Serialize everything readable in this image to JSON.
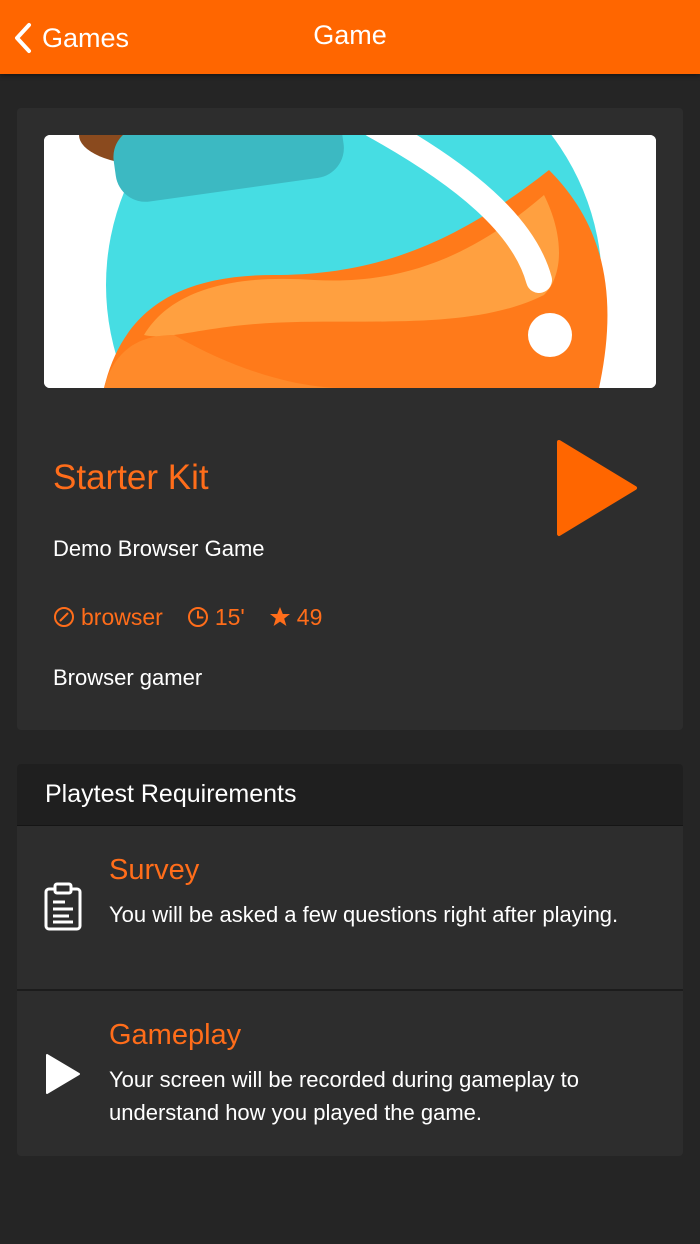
{
  "nav": {
    "back_label": "Games",
    "title": "Game"
  },
  "colors": {
    "accent": "#ff6600",
    "accent_text": "#ff6d1a",
    "background": "#252525",
    "card": "#2d2d2d"
  },
  "game": {
    "title": "Starter Kit",
    "subtitle": "Demo Browser Game",
    "platform": "browser",
    "duration": "15'",
    "rating": "49",
    "audience": "Browser gamer"
  },
  "requirements": {
    "header": "Playtest Requirements",
    "items": [
      {
        "icon": "clipboard-icon",
        "title": "Survey",
        "description": "You will be asked a few questions right after playing."
      },
      {
        "icon": "play-icon",
        "title": "Gameplay",
        "description": "Your screen will be recorded during gameplay to understand how you played the game."
      }
    ]
  }
}
